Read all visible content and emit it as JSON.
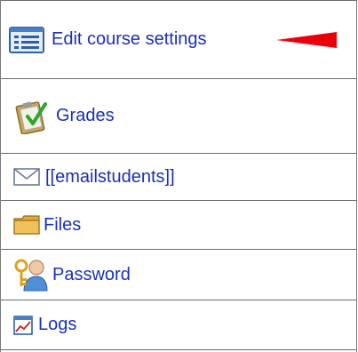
{
  "menu": {
    "items": [
      {
        "label": "Edit course settings",
        "icon": "settings-list-icon"
      },
      {
        "label": "Grades",
        "icon": "grades-clipboard-icon"
      },
      {
        "label": "[[emailstudents]]",
        "icon": "envelope-icon"
      },
      {
        "label": "Files",
        "icon": "folder-icon"
      },
      {
        "label": "Password",
        "icon": "password-user-key-icon"
      },
      {
        "label": "Logs",
        "icon": "logs-chart-icon"
      }
    ]
  },
  "annotation": {
    "icon": "red-arrow-icon",
    "color": "#e8000b"
  },
  "colors": {
    "link": "#1a2fbf",
    "border": "#6a6a6a"
  }
}
